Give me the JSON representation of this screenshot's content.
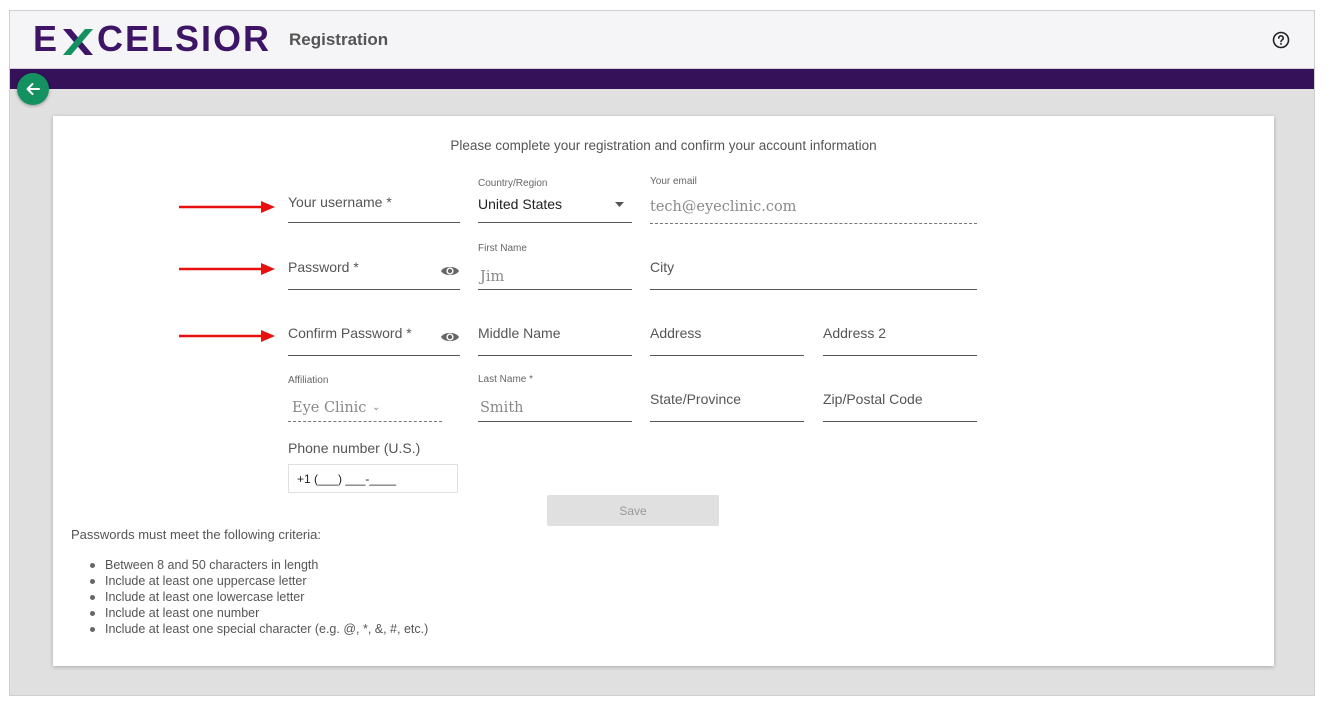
{
  "header": {
    "logo": {
      "pre": "E",
      "post": "CELSIOR"
    },
    "title": "Registration",
    "help_icon": "help-circle-icon"
  },
  "nav": {
    "back_icon": "arrow-left-icon"
  },
  "colors": {
    "brand_purple": "#35115a",
    "logo_purple": "#3d1466",
    "logo_green": "#149160",
    "back_button": "#149160",
    "arrow_red": "#e8100f"
  },
  "form": {
    "intro": "Please complete your registration and confirm your account information",
    "username": {
      "label": "Your username *"
    },
    "password": {
      "label": "Password *"
    },
    "confirm_password": {
      "label": "Confirm Password *"
    },
    "country": {
      "label": "Country/Region",
      "value": "United States"
    },
    "first_name": {
      "label": "First Name",
      "value": "Jim"
    },
    "middle_name": {
      "label": "Middle Name"
    },
    "last_name": {
      "label": "Last Name *",
      "value": "Smith"
    },
    "email": {
      "label": "Your email",
      "value": "tech@eyeclinic.com"
    },
    "city": {
      "label": "City"
    },
    "address": {
      "label": "Address"
    },
    "address2": {
      "label": "Address 2"
    },
    "state": {
      "label": "State/Province"
    },
    "zip": {
      "label": "Zip/Postal Code"
    },
    "affiliation": {
      "label": "Affiliation",
      "value": "Eye Clinic"
    },
    "phone": {
      "label": "Phone number (U.S.)",
      "value": "+1 (___) ___-____"
    },
    "save_label": "Save"
  },
  "criteria": {
    "title": "Passwords must meet the following criteria:",
    "items": [
      "Between 8 and 50 characters in length",
      "Include at least one uppercase letter",
      "Include at least one lowercase letter",
      "Include at least one number",
      "Include at least one special character (e.g. @, *, &, #, etc.)"
    ]
  }
}
